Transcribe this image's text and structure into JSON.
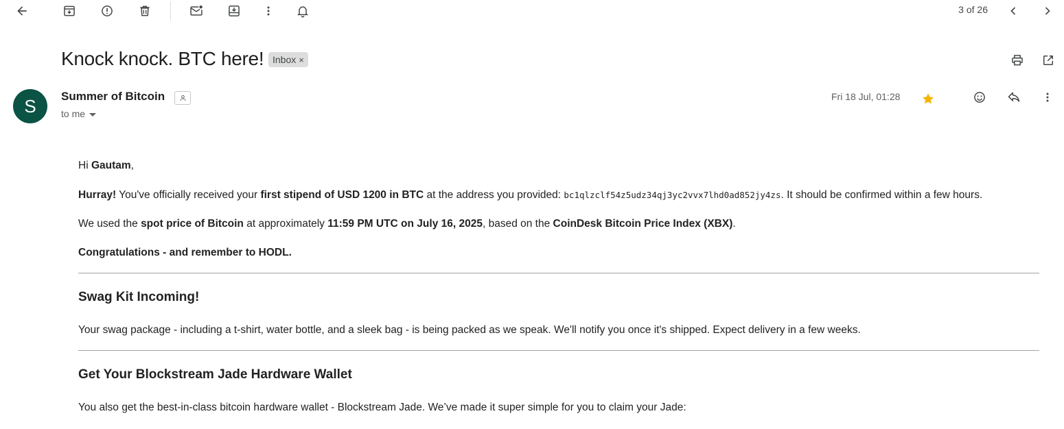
{
  "toolbar": {
    "icons": [
      "back-arrow-icon",
      "archive-icon",
      "report-spam-icon",
      "delete-icon",
      "mark-unread-icon",
      "move-to-icon",
      "more-vert-icon",
      "snooze-icon"
    ],
    "counter": "3 of 26"
  },
  "email": {
    "subject": "Knock knock. BTC here!",
    "label": "Inbox",
    "label_remove": "×",
    "sender": {
      "avatar_letter": "S",
      "avatar_color": "#0b5345",
      "name": "Summer of Bitcoin",
      "recipient": "to me"
    },
    "date": "Fri 18 Jul, 01:28",
    "starred": true,
    "star_color": "#f4b400"
  },
  "body": {
    "greeting_prefix": "Hi ",
    "greeting_name": "Gautam",
    "greeting_suffix": ",",
    "p1": {
      "hurray": "Hurray!",
      "t1": " You've officially received your ",
      "stipend": "first stipend of USD 1200 in BTC",
      "t2": " at the address you provided: ",
      "address": "bc1qlzclf54z5udz34qj3yc2vvx7lhd0ad852jy4zs",
      "t3": ". It should be confirmed within a few hours."
    },
    "p2": {
      "t1": "We used the ",
      "spot": "spot price of Bitcoin",
      "t2": " at approximately ",
      "time": "11:59 PM UTC on July 16, 2025",
      "t3": ", based on the ",
      "index": "CoinDesk Bitcoin Price Index (XBX)",
      "t4": "."
    },
    "p3": "Congratulations - and remember to HODL.",
    "swag_heading": "Swag Kit Incoming!",
    "swag_text": "Your swag package - including a t-shirt, water bottle, and a sleek bag - is being packed as we speak. We'll notify you once it's shipped. Expect delivery in a few weeks.",
    "jade_heading": "Get Your Blockstream Jade Hardware Wallet",
    "jade_text": "You also get the best-in-class bitcoin hardware wallet - Blockstream Jade. We’ve made it super simple for you to claim your Jade:"
  }
}
